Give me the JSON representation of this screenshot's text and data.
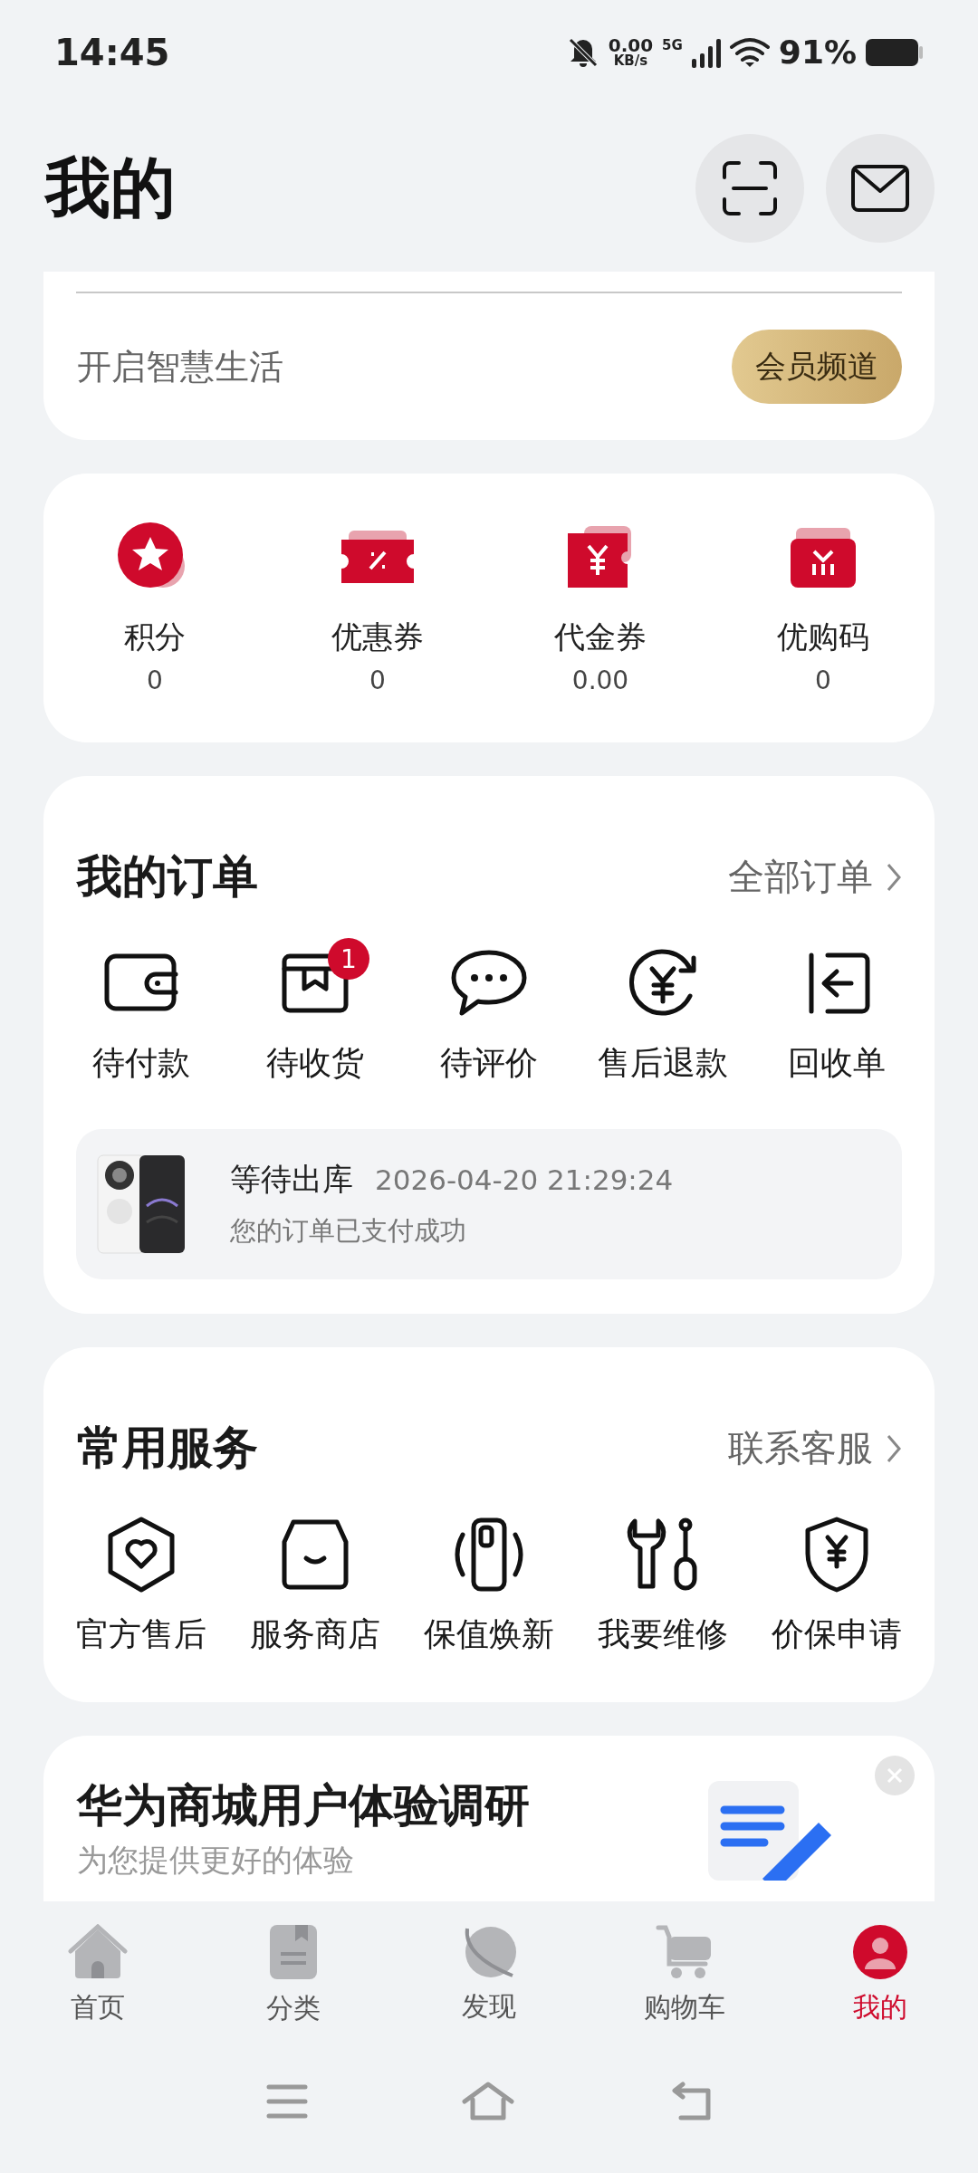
{
  "status_bar": {
    "time": "14:45",
    "net_speed": "0.00",
    "net_unit": "KB/s",
    "network": "5G",
    "battery": "91%"
  },
  "header": {
    "title": "我的"
  },
  "member": {
    "slogan": "开启智慧生活",
    "button": "会员频道"
  },
  "assets": [
    {
      "label": "积分",
      "value": "0",
      "kind": "points"
    },
    {
      "label": "优惠券",
      "value": "0",
      "kind": "coupon"
    },
    {
      "label": "代金券",
      "value": "0.00",
      "kind": "voucher"
    },
    {
      "label": "优购码",
      "value": "0",
      "kind": "code"
    }
  ],
  "orders": {
    "title": "我的订单",
    "link": "全部订单",
    "items": [
      {
        "label": "待付款",
        "kind": "wallet"
      },
      {
        "label": "待收货",
        "kind": "box",
        "badge": "1"
      },
      {
        "label": "待评价",
        "kind": "chat"
      },
      {
        "label": "售后退款",
        "kind": "refund"
      },
      {
        "label": "回收单",
        "kind": "recycle"
      }
    ],
    "latest": {
      "status": "等待出库",
      "time": "2026-04-20 21:29:24",
      "message": "您的订单已支付成功"
    }
  },
  "services": {
    "title": "常用服务",
    "link": "联系客服",
    "items": [
      {
        "label": "官方售后",
        "kind": "heart"
      },
      {
        "label": "服务商店",
        "kind": "store"
      },
      {
        "label": "保值焕新",
        "kind": "phone"
      },
      {
        "label": "我要维修",
        "kind": "tools"
      },
      {
        "label": "价保申请",
        "kind": "shield"
      }
    ]
  },
  "survey": {
    "title": "华为商城用户体验调研",
    "subtitle": "为您提供更好的体验"
  },
  "tab_bar": [
    {
      "label": "首页",
      "kind": "home",
      "selected": false
    },
    {
      "label": "分类",
      "kind": "category",
      "selected": false
    },
    {
      "label": "发现",
      "kind": "discover",
      "selected": false
    },
    {
      "label": "购物车",
      "kind": "cart",
      "selected": false
    },
    {
      "label": "我的",
      "kind": "me",
      "selected": true
    }
  ]
}
